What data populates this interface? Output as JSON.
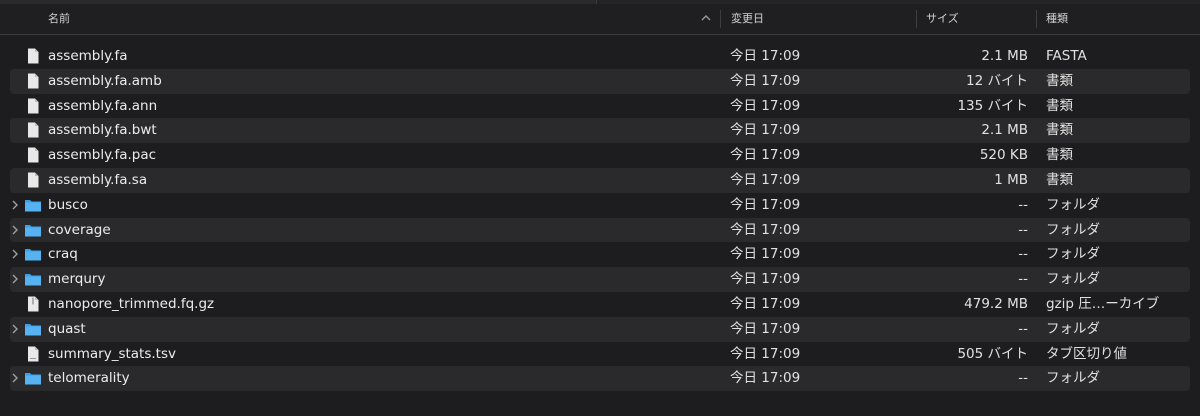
{
  "columns": {
    "name": "名前",
    "date": "変更日",
    "size": "サイズ",
    "kind": "種類"
  },
  "files": [
    {
      "name": "assembly.fa",
      "date": "今日 17:09",
      "size": "2.1 MB",
      "kind": "FASTA",
      "type": "document-icon",
      "folder": false
    },
    {
      "name": "assembly.fa.amb",
      "date": "今日 17:09",
      "size": "12 バイト",
      "kind": "書類",
      "type": "document-icon",
      "folder": false
    },
    {
      "name": "assembly.fa.ann",
      "date": "今日 17:09",
      "size": "135 バイト",
      "kind": "書類",
      "type": "document-icon",
      "folder": false
    },
    {
      "name": "assembly.fa.bwt",
      "date": "今日 17:09",
      "size": "2.1 MB",
      "kind": "書類",
      "type": "document-icon",
      "folder": false
    },
    {
      "name": "assembly.fa.pac",
      "date": "今日 17:09",
      "size": "520 KB",
      "kind": "書類",
      "type": "document-icon",
      "folder": false
    },
    {
      "name": "assembly.fa.sa",
      "date": "今日 17:09",
      "size": "1 MB",
      "kind": "書類",
      "type": "document-icon",
      "folder": false
    },
    {
      "name": "busco",
      "date": "今日 17:09",
      "size": "--",
      "kind": "フォルダ",
      "type": "folder-icon",
      "folder": true
    },
    {
      "name": "coverage",
      "date": "今日 17:09",
      "size": "--",
      "kind": "フォルダ",
      "type": "folder-icon",
      "folder": true
    },
    {
      "name": "craq",
      "date": "今日 17:09",
      "size": "--",
      "kind": "フォルダ",
      "type": "folder-icon",
      "folder": true
    },
    {
      "name": "merqury",
      "date": "今日 17:09",
      "size": "--",
      "kind": "フォルダ",
      "type": "folder-icon",
      "folder": true
    },
    {
      "name": "nanopore_trimmed.fq.gz",
      "date": "今日 17:09",
      "size": "479.2 MB",
      "kind": "gzip 圧…ーカイブ",
      "type": "archive-icon",
      "folder": false
    },
    {
      "name": "quast",
      "date": "今日 17:09",
      "size": "--",
      "kind": "フォルダ",
      "type": "folder-icon",
      "folder": true
    },
    {
      "name": "summary_stats.tsv",
      "date": "今日 17:09",
      "size": "505 バイト",
      "kind": "タブ区切り値",
      "type": "tsv-document-icon",
      "folder": false
    },
    {
      "name": "telomerality",
      "date": "今日 17:09",
      "size": "--",
      "kind": "フォルダ",
      "type": "folder-icon",
      "folder": true
    }
  ],
  "colors": {
    "folder": "#3aa0e8",
    "document": "#e8e8e8",
    "alt_row": "#2a2a2c"
  }
}
